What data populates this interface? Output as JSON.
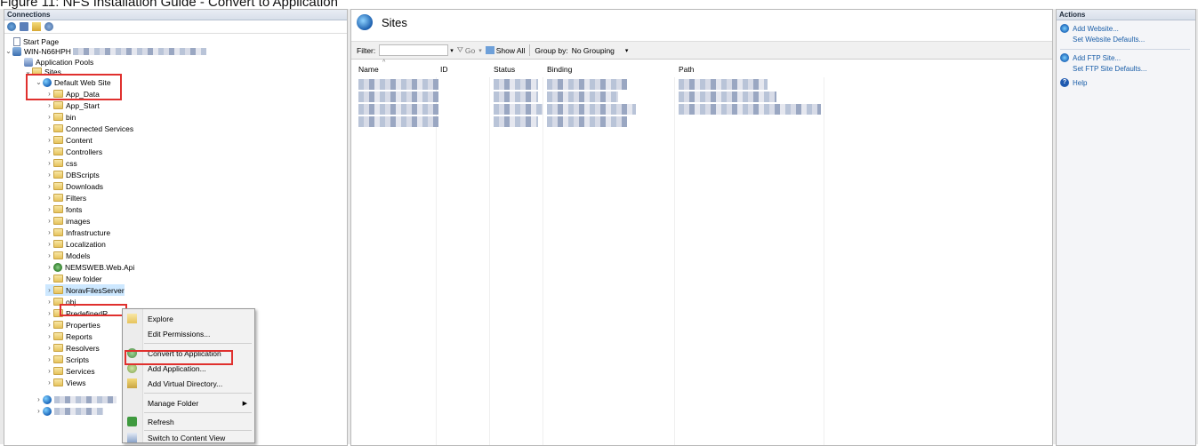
{
  "caption": "Figure 11: NFS Installation Guide - Convert to Application",
  "connections": {
    "title": "Connections",
    "tree": {
      "start_page": "Start Page",
      "server": "WIN-N66HPH",
      "app_pools": "Application Pools",
      "sites": "Sites",
      "default_site": "Default Web Site",
      "folders": [
        "App_Data",
        "App_Start",
        "bin",
        "Connected Services",
        "Content",
        "Controllers",
        "css",
        "DBScripts",
        "Downloads",
        "Filters",
        "fonts",
        "images",
        "Infrastructure",
        "Localization",
        "Models"
      ],
      "webapi": "NEMSWEB.Web.Api",
      "new_folder": "New folder",
      "selected": "NoravFilesServer",
      "folders_after": [
        "obj",
        "PredefinedR",
        "Properties",
        "Reports",
        "Resolvers",
        "Scripts",
        "Services",
        "Views"
      ]
    }
  },
  "context_menu": {
    "items": [
      "Explore",
      "Edit Permissions...",
      "Convert to Application",
      "Add Application...",
      "Add Virtual Directory...",
      "Manage Folder",
      "Refresh",
      "Switch to Content View"
    ]
  },
  "sites": {
    "title": "Sites",
    "filter_label": "Filter:",
    "go": "Go",
    "show_all": "Show All",
    "group_by_label": "Group by:",
    "group_by_value": "No Grouping",
    "columns": [
      "Name",
      "ID",
      "Status",
      "Binding",
      "Path"
    ]
  },
  "actions": {
    "title": "Actions",
    "add_website": "Add Website...",
    "set_website_defaults": "Set Website Defaults...",
    "add_ftp_site": "Add FTP Site...",
    "set_ftp_defaults": "Set FTP Site Defaults...",
    "help": "Help"
  }
}
